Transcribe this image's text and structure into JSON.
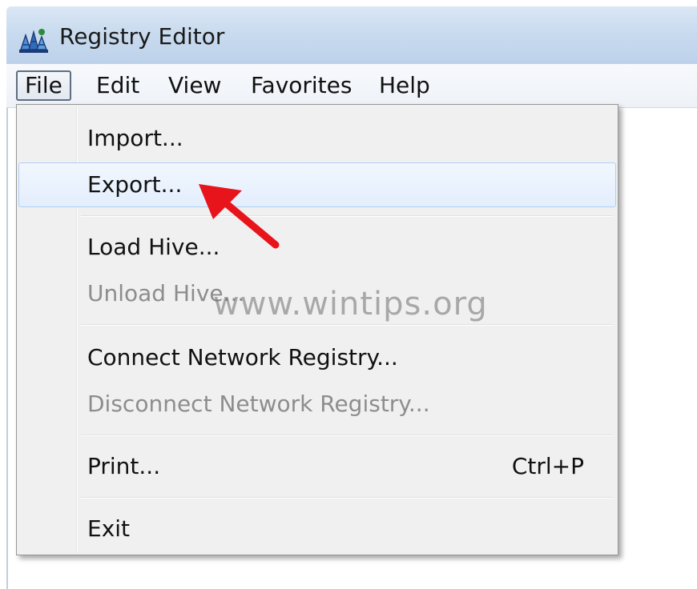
{
  "window": {
    "title": "Registry Editor",
    "icon": "registry-editor-icon"
  },
  "menubar": {
    "items": [
      {
        "label": "File",
        "active": true
      },
      {
        "label": "Edit",
        "active": false
      },
      {
        "label": "View",
        "active": false
      },
      {
        "label": "Favorites",
        "active": false
      },
      {
        "label": "Help",
        "active": false
      }
    ]
  },
  "file_menu": {
    "items": [
      {
        "label": "Import...",
        "enabled": true,
        "shortcut": ""
      },
      {
        "label": "Export...",
        "enabled": true,
        "shortcut": "",
        "highlighted": true
      },
      {
        "label": "Load Hive...",
        "enabled": true,
        "shortcut": ""
      },
      {
        "label": "Unload Hive...",
        "enabled": false,
        "shortcut": ""
      },
      {
        "label": "Connect Network Registry...",
        "enabled": true,
        "shortcut": ""
      },
      {
        "label": "Disconnect Network Registry...",
        "enabled": false,
        "shortcut": ""
      },
      {
        "label": "Print...",
        "enabled": true,
        "shortcut": "Ctrl+P"
      },
      {
        "label": "Exit",
        "enabled": true,
        "shortcut": ""
      }
    ]
  },
  "annotation": {
    "arrow_color": "#e8141c",
    "points_to": "Export..."
  },
  "watermark": {
    "text": "www.wintips.org"
  },
  "colors": {
    "menu_background": "#f0f0f0",
    "highlight_border": "#aecff7",
    "disabled_text": "#8d8d8d"
  }
}
